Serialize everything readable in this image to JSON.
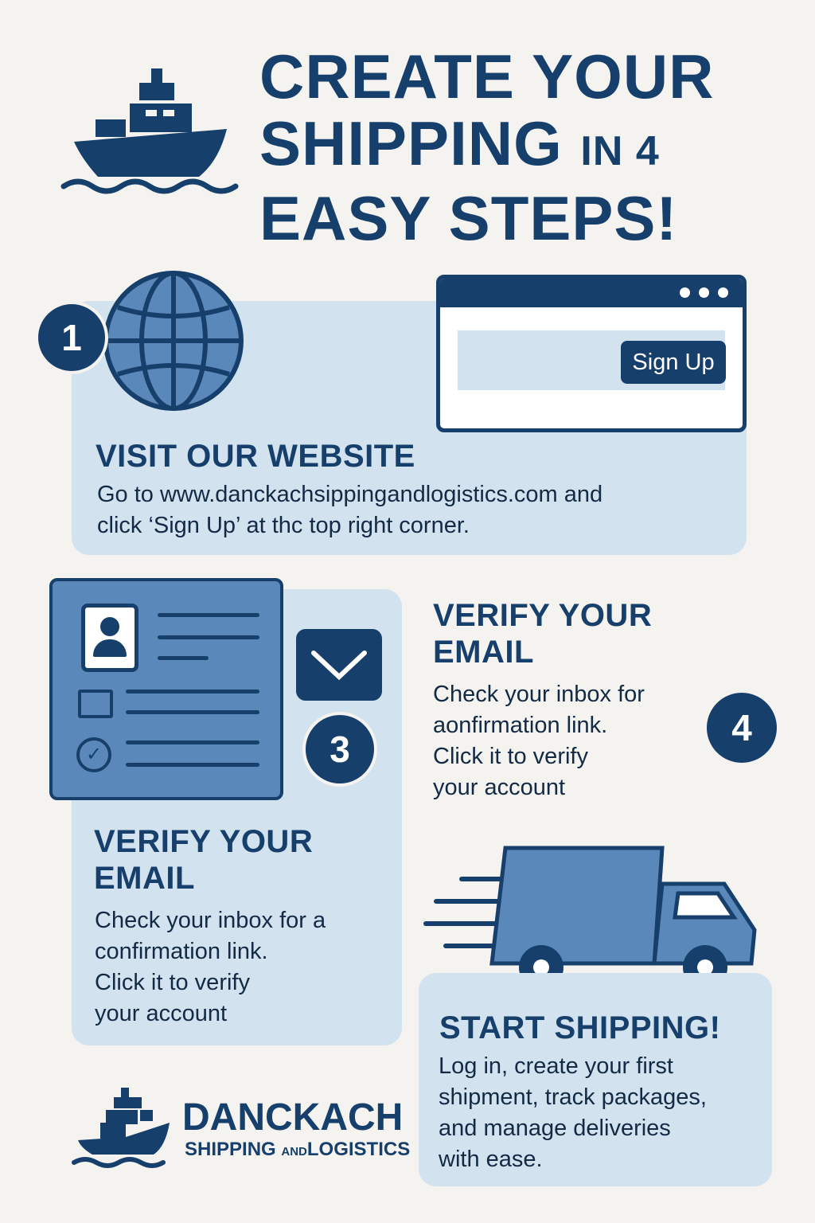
{
  "header": {
    "title_line1": "CREATE YOUR",
    "title_line2": "SHIPPING",
    "title_line2_small": "IN 4",
    "title_line3": "EASY STEPS!"
  },
  "step1": {
    "number": "1",
    "heading": "VISIT OUR WEBSITE",
    "body_line1": "Go to www.danckachsippingandlogistics.com and",
    "body_line2": "click ‘Sign Up’ at thc top right corner.",
    "browser_button": "Sign Up"
  },
  "step3": {
    "number": "3",
    "heading_line1": "VERIFY YOUR",
    "heading_line2": "EMAIL",
    "body": [
      "Check your inbox for a",
      "confirmation link.",
      "Click it to verify",
      "your account"
    ]
  },
  "step2": {
    "heading_line1": "VERIFY YOUR",
    "heading_line2": "EMAIL",
    "body": [
      "Check your inbox for",
      "aonfirmation link.",
      "Click it to verify",
      "your account"
    ]
  },
  "step4": {
    "number": "4",
    "heading": "START SHIPPING!",
    "body": [
      "Log in, create your first",
      "shipment, track packages,",
      "and manage deliveries",
      "with ease."
    ]
  },
  "logo": {
    "name": "DANCKACH",
    "sub_left": "SHIPPING",
    "sub_mid": "AND",
    "sub_right": "LOGISTICS"
  },
  "colors": {
    "navy": "#163f6b",
    "mid_blue": "#5b88bb",
    "panel": "#d3e2ef",
    "background": "#f4f3ef"
  }
}
